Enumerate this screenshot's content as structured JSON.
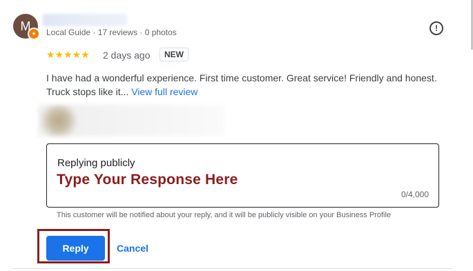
{
  "reviewer": {
    "avatar_letter": "M",
    "meta": "Local Guide · 17 reviews · 0 photos",
    "avatar_color": "#6d4c41"
  },
  "review": {
    "stars": "★★★★★",
    "rating": 5,
    "date": "2 days ago",
    "badge": "NEW",
    "text": "I have had a wonderful experience. First time customer. Great service! Friendly and honest. Truck stops like it...",
    "view_full": "View full review"
  },
  "reply_form": {
    "label": "Replying publicly",
    "annotation": "Type Your Response Here",
    "counter": "0/4,000",
    "notice": "This customer will be notified about your reply, and it will be publicly visible on your Business Profile"
  },
  "actions": {
    "reply_label": "Reply",
    "cancel_label": "Cancel"
  },
  "icons": {
    "report": "report-icon",
    "guide_badge": "local-guide-badge-icon"
  },
  "colors": {
    "accent": "#1a73e8",
    "star": "#fbbc04",
    "annotation": "#8b1d1d"
  }
}
